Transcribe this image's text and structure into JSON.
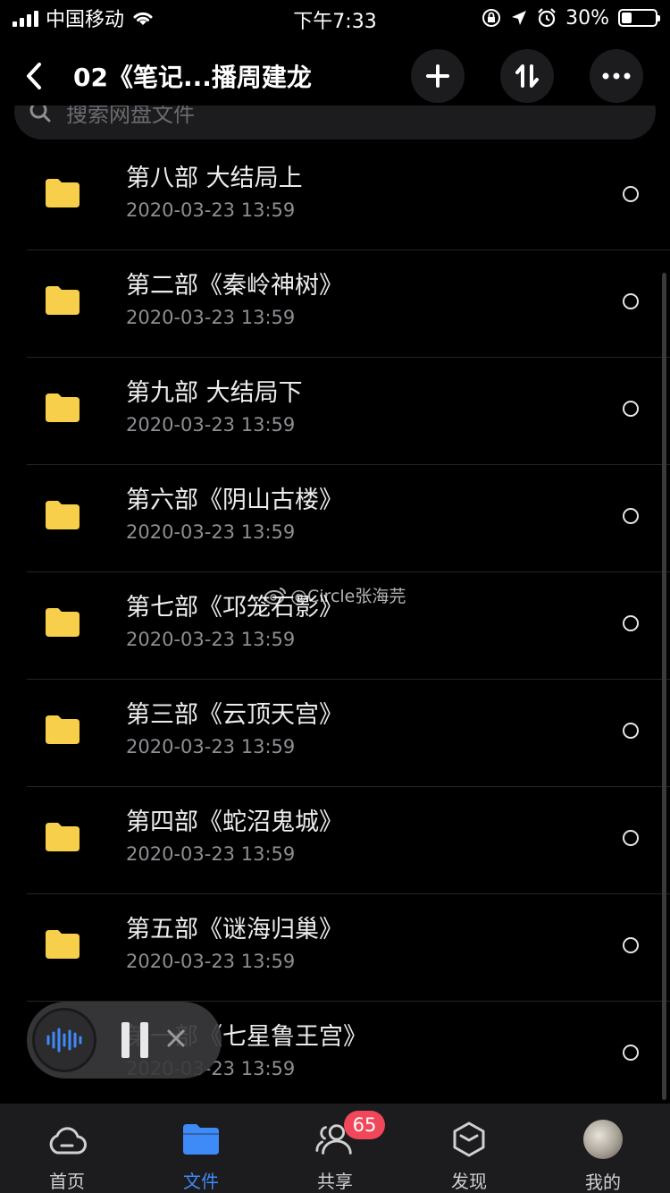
{
  "status_bar": {
    "carrier": "中国移动",
    "time": "下午7:33",
    "battery_percent": "30%",
    "battery_level": 0.3
  },
  "header": {
    "title": "02《笔记...播周建龙"
  },
  "search": {
    "placeholder": "搜索网盘文件"
  },
  "files": [
    {
      "name": "第八部 大结局上",
      "date": "2020-03-23 13:59"
    },
    {
      "name": "第二部《秦岭神树》",
      "date": "2020-03-23 13:59"
    },
    {
      "name": "第九部 大结局下",
      "date": "2020-03-23 13:59"
    },
    {
      "name": "第六部《阴山古楼》",
      "date": "2020-03-23 13:59"
    },
    {
      "name": "第七部《邛笼石影》",
      "date": "2020-03-23 13:59"
    },
    {
      "name": "第三部《云顶天宫》",
      "date": "2020-03-23 13:59"
    },
    {
      "name": "第四部《蛇沼鬼城》",
      "date": "2020-03-23 13:59"
    },
    {
      "name": "第五部《谜海归巢》",
      "date": "2020-03-23 13:59"
    },
    {
      "name": "第一部《七星鲁王宫》",
      "date": "2020-03-23 13:59"
    }
  ],
  "watermark": "@Circle张海芫",
  "tabs": [
    {
      "label": "首页",
      "icon": "cloud-icon"
    },
    {
      "label": "文件",
      "icon": "folder-icon"
    },
    {
      "label": "共享",
      "icon": "people-icon",
      "badge": "65"
    },
    {
      "label": "发现",
      "icon": "cube-icon"
    },
    {
      "label": "我的",
      "icon": "avatar"
    }
  ],
  "colors": {
    "background": "#000000",
    "accent": "#3e8af7",
    "folder": "#f7cf4a",
    "badge": "#f0475a"
  }
}
